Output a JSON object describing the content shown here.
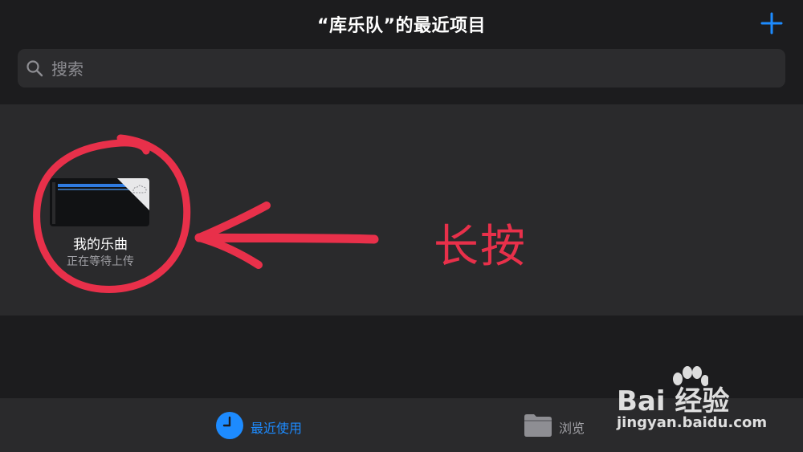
{
  "header": {
    "title": "“库乐队”的最近项目",
    "add_icon": "plus-icon",
    "accent_color": "#1d8bff"
  },
  "search": {
    "placeholder": "搜索",
    "icon": "search-icon"
  },
  "documents": [
    {
      "name": "我的乐曲",
      "status": "正在等待上传",
      "icon": "cloud-upload-icon"
    }
  ],
  "annotation": {
    "text": "长按",
    "color": "#e8304a"
  },
  "tabbar": {
    "tabs": [
      {
        "label": "最近使用",
        "icon": "clock-icon",
        "selected": true
      },
      {
        "label": "浏览",
        "icon": "folder-icon",
        "selected": false
      }
    ]
  },
  "watermark": {
    "brand": "Bai 经验",
    "url": "jingyan.baidu.com"
  }
}
